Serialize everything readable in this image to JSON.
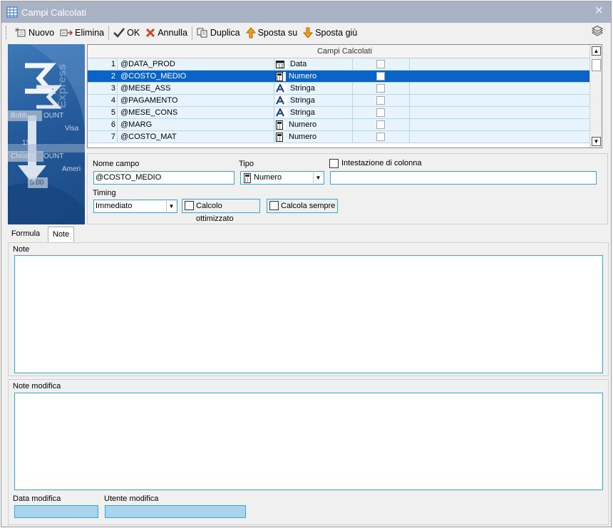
{
  "window": {
    "title": "Campi Calcolati"
  },
  "toolbar": {
    "nuovo": "Nuovo",
    "elimina": "Elimina",
    "ok": "OK",
    "annulla": "Annulla",
    "duplica": "Duplica",
    "sposta_su": "Sposta su",
    "sposta_giu": "Sposta giù"
  },
  "side_image": {
    "ghost_texts": [
      "Bobb",
      "OUNT",
      "Visa",
      "Christ",
      "OUNT",
      "Ameri",
      "5.00",
      "1S",
      "Express"
    ]
  },
  "grid": {
    "header": "Campi Calcolati",
    "rows": [
      {
        "num": "1",
        "name": "@DATA_PROD",
        "type": "Data",
        "icon": "calendar-icon",
        "selected": false
      },
      {
        "num": "2",
        "name": "@COSTO_MEDIO",
        "type": "Numero",
        "icon": "calculator-icon",
        "selected": true
      },
      {
        "num": "3",
        "name": "@MESE_ASS",
        "type": "Stringa",
        "icon": "text-a-icon",
        "selected": false
      },
      {
        "num": "4",
        "name": "@PAGAMENTO",
        "type": "Stringa",
        "icon": "text-a-icon",
        "selected": false
      },
      {
        "num": "5",
        "name": "@MESE_CONS",
        "type": "Stringa",
        "icon": "text-a-icon",
        "selected": false
      },
      {
        "num": "6",
        "name": "@MARG",
        "type": "Numero",
        "icon": "calculator-icon",
        "selected": false
      },
      {
        "num": "7",
        "name": "@COSTO_MAT",
        "type": "Numero",
        "icon": "calculator-icon",
        "selected": false
      }
    ]
  },
  "fields": {
    "nome_campo_label": "Nome campo",
    "nome_campo_value": "@COSTO_MEDIO",
    "tipo_label": "Tipo",
    "tipo_value": "Numero",
    "intestazione_label": "Intestazione di colonna",
    "intestazione_value": "",
    "timing_label": "Timing",
    "timing_value": "Immediato",
    "calcolo_ottimizzato": "Calcolo ottimizzato",
    "calcola_sempre": "Calcola sempre"
  },
  "tabs": [
    {
      "label": "Formula",
      "active": false
    },
    {
      "label": "Note",
      "active": true
    }
  ],
  "note": {
    "note_label": "Note",
    "note_value": "",
    "note_modifica_label": "Note modifica",
    "note_modifica_value": "",
    "data_modifica_label": "Data modifica",
    "data_modifica_value": "",
    "utente_modifica_label": "Utente modifica",
    "utente_modifica_value": ""
  },
  "colors": {
    "title_bar": "#aab3c6",
    "selection": "#0a64c8",
    "row_bg": "#e8f4fc",
    "input_border": "#35a6d6",
    "readonly_fill": "#a8d4ee"
  }
}
